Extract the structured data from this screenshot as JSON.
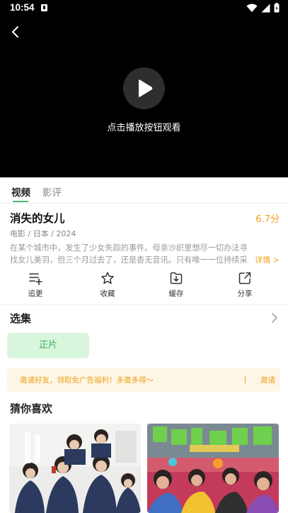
{
  "status_bar": {
    "time": "10:54"
  },
  "player": {
    "hint": "点击播放按钮观看"
  },
  "tabs": [
    {
      "label": "视频"
    },
    {
      "label": "影评"
    }
  ],
  "movie": {
    "title": "消失的女儿",
    "score": "6.7分",
    "meta": "电影 / 日本 / 2024",
    "description": "在某个城市中，发生了少女失踪的事件。母亲沙织里想尽一切办法寻找女儿美羽，但三个月过去了，还是杳无音讯。只有唯一一位持续采访的当地电...",
    "more_label": "详情 >"
  },
  "actions": [
    {
      "label": "追更",
      "icon": "playlist-add-icon"
    },
    {
      "label": "收藏",
      "icon": "star-icon"
    },
    {
      "label": "缓存",
      "icon": "download-icon"
    },
    {
      "label": "分享",
      "icon": "share-icon"
    }
  ],
  "episodes": {
    "title": "选集",
    "items": [
      {
        "label": "正片"
      }
    ]
  },
  "promo": {
    "text": "邀请好友，领取免广告福利！多邀多得～",
    "button": "邀请"
  },
  "recommend": {
    "title": "猜你喜欢"
  },
  "colors": {
    "accent": "#4ab86a",
    "score": "#f0a21b",
    "episode_bg": "#d8f5dd",
    "promo_bg": "#fdf6e7"
  }
}
